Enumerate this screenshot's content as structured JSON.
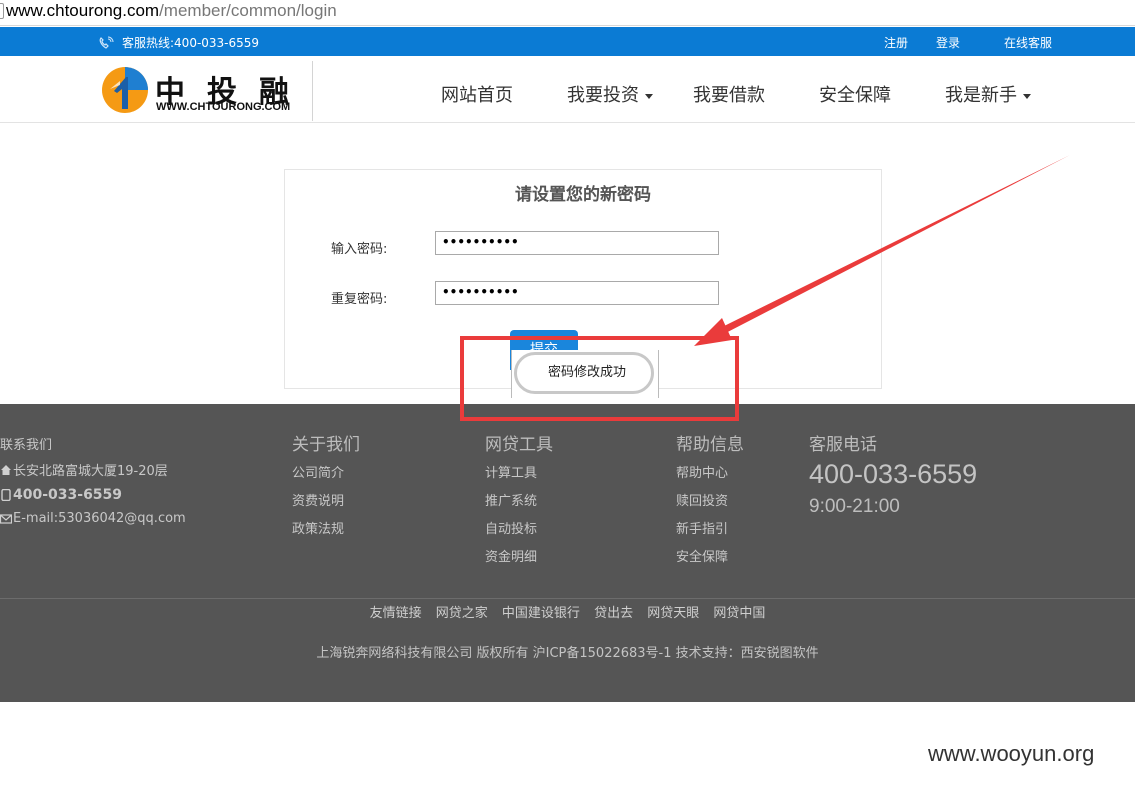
{
  "browser": {
    "url_host": "www.chtourong.com",
    "url_path": "/member/common/login"
  },
  "topbar": {
    "hotline": "客服热线:400-033-6559",
    "register": "注册",
    "login": "登录",
    "online_service": "在线客服",
    "color": "#0b7bd4"
  },
  "logo": {
    "cn": "中投融",
    "en": "WWW.CHTOURONG.COM"
  },
  "nav": {
    "items": [
      {
        "label": "网站首页"
      },
      {
        "label": "我要投资"
      },
      {
        "label": "我要借款"
      },
      {
        "label": "安全保障"
      },
      {
        "label": "我是新手"
      }
    ]
  },
  "form": {
    "title": "请设置您的新密码",
    "password_label": "输入密码:",
    "password_value": "••••••••••",
    "confirm_label": "重复密码:",
    "confirm_value": "••••••••••",
    "submit_label": "提交"
  },
  "toast": {
    "message": "密码修改成功"
  },
  "footer": {
    "contact": {
      "heading": "联系我们",
      "address": "长安北路富城大厦19-20层",
      "phone": "400-033-6559",
      "email": "E-mail:53036042@qq.com"
    },
    "about": {
      "heading": "关于我们",
      "links": [
        "公司简介",
        "资费说明",
        "政策法规"
      ]
    },
    "tools": {
      "heading": "网贷工具",
      "links": [
        "计算工具",
        "推广系统",
        "自动投标",
        "资金明细"
      ]
    },
    "help": {
      "heading": "帮助信息",
      "links": [
        "帮助中心",
        "赎回投资",
        "新手指引",
        "安全保障"
      ]
    },
    "service": {
      "heading": "客服电话",
      "phone": "400-033-6559",
      "hours": "9:00-21:00"
    },
    "friend_links": [
      "友情链接",
      "网贷之家",
      "中国建设银行",
      "贷出去",
      "网贷天眼",
      "网贷中国"
    ],
    "copyright": "上海锐奔网络科技有限公司 版权所有 沪ICP备15022683号-1 技术支持：西安锐图软件"
  },
  "watermark": "www.wooyun.org"
}
